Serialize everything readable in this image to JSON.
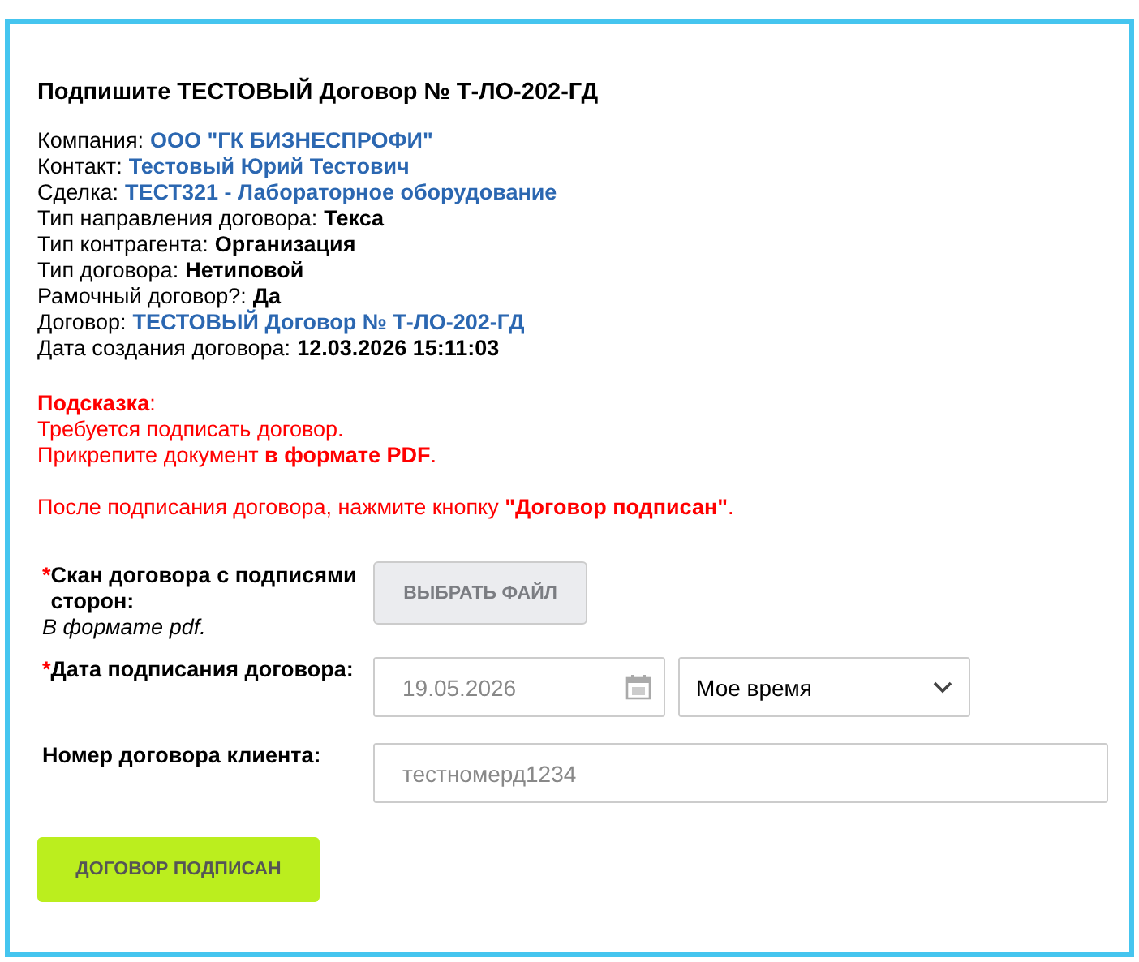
{
  "title": "Подпишите ТЕСТОВЫЙ Договор № Т-ЛО-202-ГД",
  "details": [
    {
      "label": "Компания:",
      "value": "ООО \"ГК БИЗНЕСПРОФИ\"",
      "kind": "link"
    },
    {
      "label": "Контакт:",
      "value": "Тестовый Юрий Тестович",
      "kind": "link"
    },
    {
      "label": "Сделка:",
      "value": "ТЕСТ321 - Лабораторное оборудование",
      "kind": "link"
    },
    {
      "label": "Тип направления договора:",
      "value": "Текса",
      "kind": "text"
    },
    {
      "label": "Тип контрагента:",
      "value": "Организация",
      "kind": "text"
    },
    {
      "label": "Тип договора:",
      "value": "Нетиповой",
      "kind": "text"
    },
    {
      "label": "Рамочный договор?:",
      "value": "Да",
      "kind": "text"
    },
    {
      "label": "Договор:",
      "value": "ТЕСТОВЫЙ Договор № Т-ЛО-202-ГД",
      "kind": "link"
    },
    {
      "label": "Дата создания договора:",
      "value": "12.03.2026 15:11:03",
      "kind": "text"
    }
  ],
  "hint": {
    "lines": [
      "**Подсказка**:",
      "Требуется подписать договор.",
      "Прикрепите документ **в формате PDF**."
    ],
    "note": "После подписания договора, нажмите кнопку **\"Договор подписан\"**."
  },
  "form": [
    {
      "kind": "file",
      "required_mark": "*",
      "label": "Скан договора с подписями сторон:",
      "note": "В формате pdf.",
      "button": "ВЫБРАТЬ ФАЙЛ"
    },
    {
      "kind": "date",
      "required_mark": "*",
      "label": "Дата подписания договора:",
      "value": "19.05.2026",
      "select": "Мое время"
    },
    {
      "kind": "text",
      "label": "Номер договора клиента:",
      "value": "тестномерд1234"
    }
  ],
  "submit": "ДОГОВОР ПОДПИСАН"
}
